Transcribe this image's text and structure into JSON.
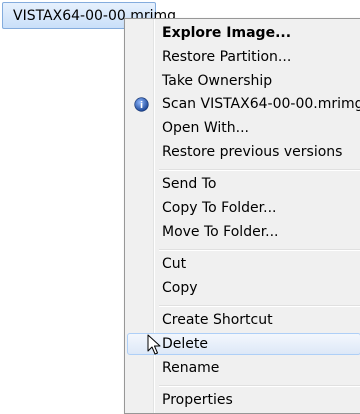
{
  "file": {
    "name": "VISTAX64-00-00.mrimg",
    "icon": "macrium-image-file-icon"
  },
  "menu": {
    "explore_image": "Explore Image...",
    "restore_partition": "Restore Partition...",
    "take_ownership": "Take Ownership",
    "scan": "Scan VISTAX64-00-00.mrimg",
    "open_with": "Open With...",
    "restore_previous_versions": "Restore previous versions",
    "send_to": "Send To",
    "copy_to_folder": "Copy To Folder...",
    "move_to_folder": "Move To Folder...",
    "cut": "Cut",
    "copy": "Copy",
    "create_shortcut": "Create Shortcut",
    "delete": "Delete",
    "rename": "Rename",
    "properties": "Properties"
  },
  "colors": {
    "menu_background": "#f0f0f0",
    "hover_border": "#aecff7",
    "selection_border": "#84acdd"
  }
}
